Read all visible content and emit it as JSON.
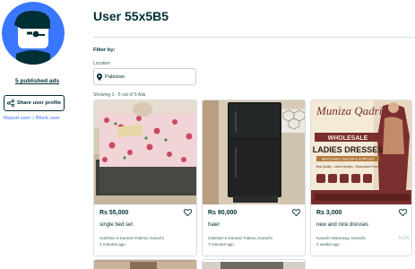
{
  "profile": {
    "published_ads": "5 published ads",
    "share_label": "Share user profile",
    "report_label": "Report user",
    "separator": "|",
    "block_label": "Block user"
  },
  "main": {
    "title": "User 55x5B5",
    "filter_label": "Filter by:",
    "location_label": "Location",
    "location_value": "Pakistan",
    "showing_text": "Showing 1 - 5 out of 5 Ads"
  },
  "listings": [
    {
      "price": "Rs 55,000",
      "title": "single bed set",
      "location": "Gulshan-e-Kaneez Fatima, Karachi",
      "time": "3 minutes ago"
    },
    {
      "price": "Rs 90,000",
      "title": "haier",
      "location": "Gulshan-e-Kaneez Fatima, Karachi",
      "time": "7 minutes ago"
    },
    {
      "price": "Rs 3,000",
      "title": "new and nice dresses",
      "location": "Karachi Motorway, Karachi",
      "time": "2 weeks ago"
    }
  ],
  "poster": {
    "brand": "Muniza Qadri",
    "line1": "WHOLESALE",
    "line2": "LADIES DRESSES",
    "line3": "WHOLESALE DEALER & SUPPLIER",
    "line4": "Best Quality - Latest Designs - Reasonable Prices"
  },
  "watermark": "Activ",
  "colors": {
    "primary": "#002f34",
    "link": "#3a77ff",
    "avatar_bg": "#3a77ff"
  },
  "icons": [
    "avatar-icon",
    "share-icon",
    "location-pin-icon",
    "heart-icon"
  ]
}
